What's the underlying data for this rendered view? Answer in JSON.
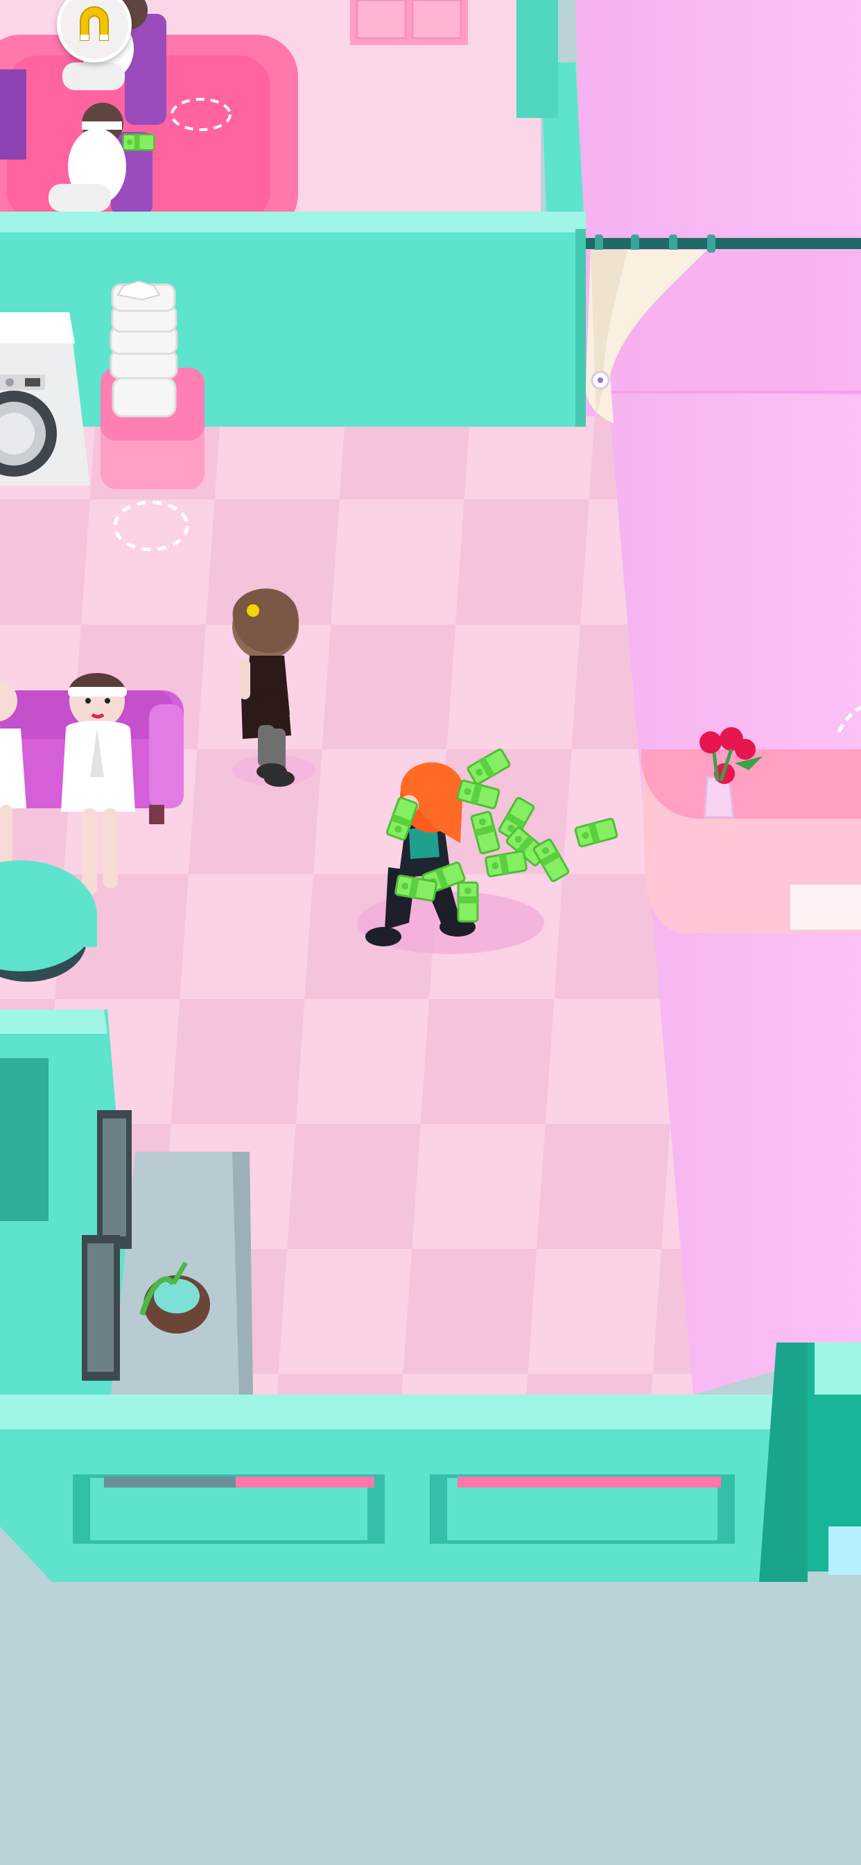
{
  "scene": {
    "type": "isometric spa management game",
    "hud": {
      "icon": "magnet-icon",
      "color": "#f3c300"
    },
    "colors": {
      "floor_light": "#fbd2e6",
      "floor_dark": "#f6c0db",
      "wall_mint": "#5ee3cd",
      "wall_mint_light": "#9ff5e6",
      "outside_pink": "#f8b9f2",
      "rug": "#ff77ab",
      "sofa": "#d55fd8",
      "money": "#7ee85c",
      "reception_desk": "#ffc6d6",
      "ground_outside": "#b9d3d8"
    },
    "objects": [
      "player-character-carrying-money",
      "spa-staff-worker",
      "waiting-customer-1",
      "waiting-customer-2",
      "customer-in-room-1",
      "customer-in-room-2",
      "washing-machine",
      "towel-stack",
      "waiting-sofa",
      "reception-desk",
      "rose-vase",
      "potted-plant",
      "window-curtain"
    ]
  }
}
